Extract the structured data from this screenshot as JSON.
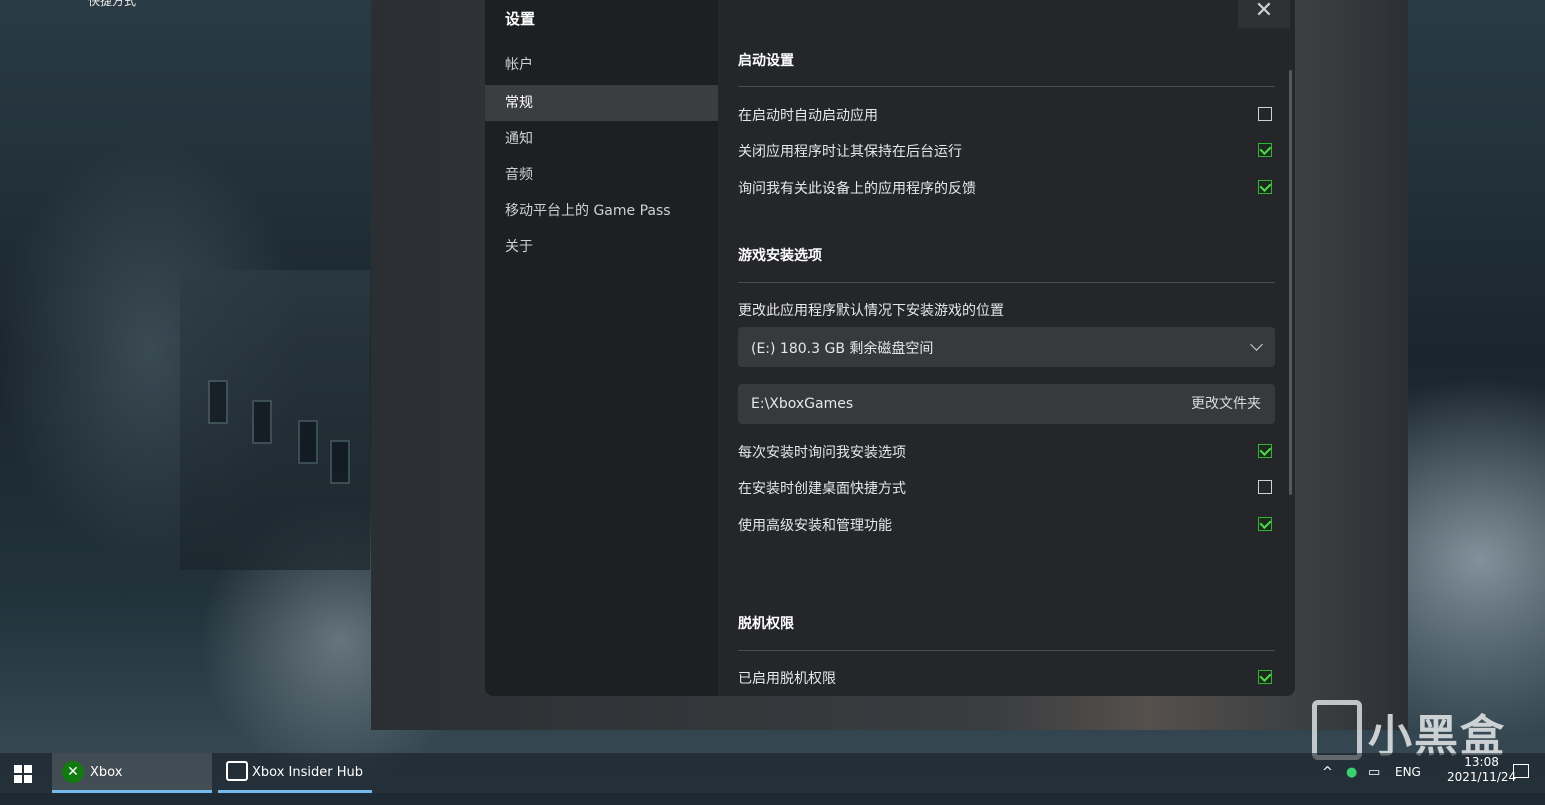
{
  "desktop": {
    "shortcut_label": "快捷方式",
    "watermark": "小黑盒"
  },
  "dialog": {
    "title": "设置",
    "close_glyph": "✕",
    "nav": [
      {
        "label": "帐户",
        "active": false
      },
      {
        "label": "常规",
        "active": true
      },
      {
        "label": "通知",
        "active": false
      },
      {
        "label": "音频",
        "active": false
      },
      {
        "label": "移动平台上的 Game Pass",
        "active": false
      },
      {
        "label": "关于",
        "active": false
      }
    ],
    "sections": {
      "startup": {
        "title": "启动设置",
        "options": [
          {
            "label": "在启动时自动启动应用",
            "checked": false
          },
          {
            "label": "关闭应用程序时让其保持在后台运行",
            "checked": true
          },
          {
            "label": "询问我有关此设备上的应用程序的反馈",
            "checked": true
          }
        ]
      },
      "install": {
        "title": "游戏安装选项",
        "location_label": "更改此应用程序默认情况下安装游戏的位置",
        "drive_value": "(E:) 180.3 GB 剩余磁盘空间",
        "path_value": "E:\\XboxGames",
        "change_folder": "更改文件夹",
        "options": [
          {
            "label": "每次安装时询问我安装选项",
            "checked": true
          },
          {
            "label": "在安装时创建桌面快捷方式",
            "checked": false
          },
          {
            "label": "使用高级安装和管理功能",
            "checked": true
          }
        ]
      },
      "offline": {
        "title": "脱机权限",
        "options": [
          {
            "label": "已启用脱机权限",
            "checked": true
          }
        ]
      }
    }
  },
  "taskbar": {
    "apps": [
      {
        "label": "Xbox",
        "icon": "xbox-icon"
      },
      {
        "label": "Xbox Insider Hub",
        "icon": "insider-hub-icon"
      }
    ],
    "language": "ENG",
    "time": "13:08",
    "date": "2021/11/24"
  },
  "colors": {
    "accent_check": "#4ddb4d",
    "dialog_bg": "#242629",
    "nav_bg": "#1d1f22",
    "nav_active": "#3b3d41"
  }
}
